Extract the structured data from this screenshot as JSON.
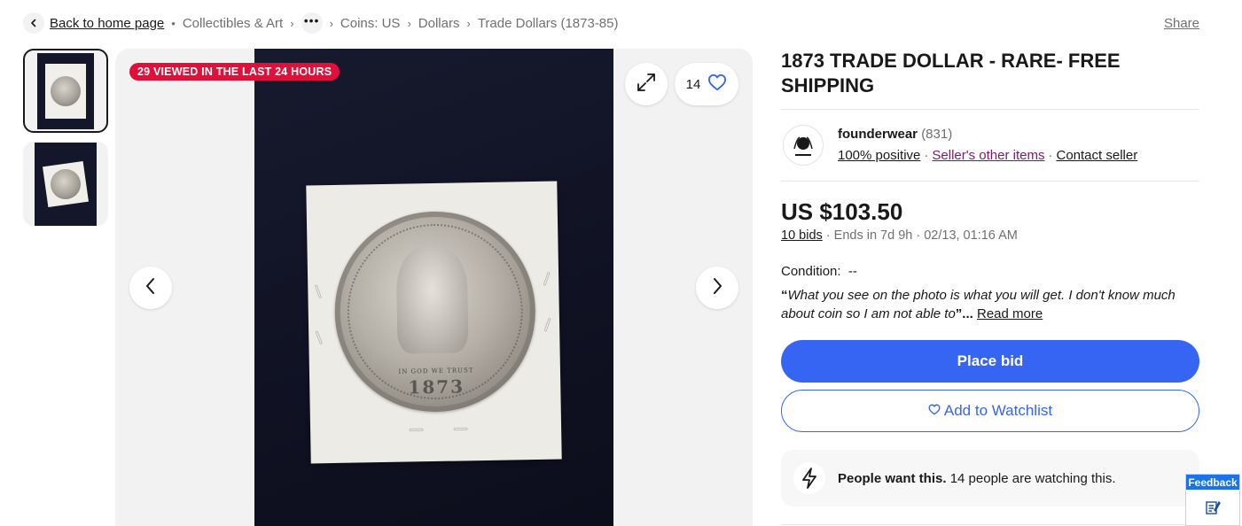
{
  "breadcrumb": {
    "back_label": "Back to home page",
    "items": [
      "Collectibles & Art",
      "Coins: US",
      "Dollars",
      "Trade Dollars (1873-85)"
    ],
    "more_label": "•••"
  },
  "share_label": "Share",
  "gallery": {
    "viewed_badge": "29 VIEWED IN THE LAST 24 HOURS",
    "watch_count": "14",
    "coin_motto": "IN GOD WE TRUST",
    "coin_year": "1873"
  },
  "listing": {
    "title": "1873 TRADE DOLLAR - RARE- FREE SHIPPING",
    "seller": {
      "name": "founderwear",
      "feedback_count": "(831)",
      "positive": "100% positive",
      "other_items": "Seller's other items",
      "contact": "Contact seller"
    },
    "price": "US $103.50",
    "bids": "10 bids",
    "ends": "· Ends in 7d 9h · 02/13, 01:16 AM",
    "condition_label": "Condition:",
    "condition_value": "--",
    "quote_open": "“",
    "quote_text": "What you see on the photo is what you will get. I don't know much about coin so I am not able to",
    "quote_close": "”",
    "ellipsis": "...",
    "read_more": "Read more",
    "place_bid": "Place bid",
    "add_watchlist": "Add to Watchlist",
    "signal_bold": "People want this.",
    "signal_text": " 14 people are watching this."
  },
  "feedback_label": "Feedback",
  "colors": {
    "primary_blue": "#3665f3",
    "badge_red": "#e0103a",
    "link_purple": "#7a1a6e",
    "feedback_blue": "#1a73e8"
  }
}
